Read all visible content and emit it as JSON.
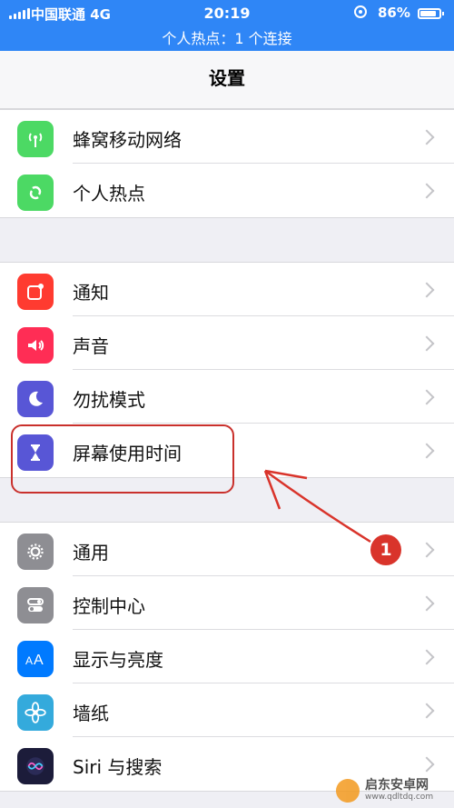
{
  "status_bar": {
    "carrier": "中国联通  4G",
    "time": "20:19",
    "battery_percent": "86%",
    "battery_level": 0.86,
    "hotspot_banner": "个人热点：1 个连接"
  },
  "nav": {
    "title": "设置"
  },
  "groups": [
    [
      {
        "label": "蜂窝移动网络",
        "icon": "antenna-icon",
        "color": "#4cd964"
      },
      {
        "label": "个人热点",
        "icon": "hotspot-link-icon",
        "color": "#4cd964"
      }
    ],
    [
      {
        "label": "通知",
        "icon": "notifications-icon",
        "color": "#ff3b30"
      },
      {
        "label": "声音",
        "icon": "speaker-icon",
        "color": "#ff2d55"
      },
      {
        "label": "勿扰模式",
        "icon": "moon-icon",
        "color": "#5856d6"
      },
      {
        "label": "屏幕使用时间",
        "icon": "hourglass-icon",
        "color": "#5856d6"
      }
    ],
    [
      {
        "label": "通用",
        "icon": "gear-icon",
        "color": "#8e8e93"
      },
      {
        "label": "控制中心",
        "icon": "toggles-icon",
        "color": "#8e8e93"
      },
      {
        "label": "显示与亮度",
        "icon": "text-size-icon",
        "color": "#007aff"
      },
      {
        "label": "墙纸",
        "icon": "flower-icon",
        "color": "#34aadc"
      },
      {
        "label": "Siri 与搜索",
        "icon": "siri-icon",
        "color": "#1c1c3a"
      }
    ]
  ],
  "annotation": {
    "badge_number": "1",
    "color": "#d9342b"
  },
  "watermark": {
    "name": "启东安卓网",
    "url": "www.qdltdq.com"
  }
}
